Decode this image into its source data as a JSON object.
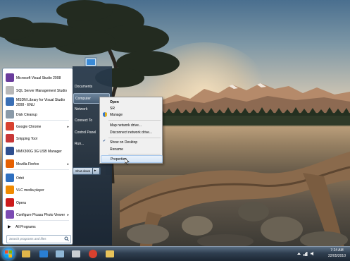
{
  "start_menu": {
    "pinned": [
      {
        "label": "Microsoft Visual Studio 2008",
        "icon": "visual-studio-icon",
        "arrow": false,
        "color": "#6a3c9c"
      },
      {
        "label": "SQL Server Management Studio",
        "icon": "sql-server-icon",
        "arrow": false,
        "color": "#b8b8b8"
      },
      {
        "label": "MSDN Library for Visual Studio 2008 - ENU",
        "icon": "msdn-library-icon",
        "arrow": false,
        "color": "#3a6fb5"
      },
      {
        "label": "Disk Cleanup",
        "icon": "disk-cleanup-icon",
        "arrow": false,
        "color": "#8a9aa8"
      },
      {
        "label": "Google Chrome",
        "icon": "chrome-icon",
        "arrow": true,
        "color": "#d8412f"
      },
      {
        "label": "Snipping Tool",
        "icon": "snipping-tool-icon",
        "arrow": false,
        "color": "#c83737"
      },
      {
        "label": "MMX300G 3G USB Manager",
        "icon": "usb-manager-icon",
        "arrow": false,
        "color": "#2f4f8f"
      },
      {
        "label": "Mozilla Firefox",
        "icon": "firefox-icon",
        "arrow": true,
        "color": "#e66000"
      },
      {
        "label": "Orbit",
        "icon": "orbit-icon",
        "arrow": false,
        "color": "#2f70c0"
      },
      {
        "label": "VLC media player",
        "icon": "vlc-icon",
        "arrow": false,
        "color": "#f08a00"
      },
      {
        "label": "Opera",
        "icon": "opera-icon",
        "arrow": false,
        "color": "#cc1b1b"
      },
      {
        "label": "Configure Picasa Photo Viewer",
        "icon": "picasa-icon",
        "arrow": true,
        "color": "#7c4bb3"
      }
    ],
    "all_programs": "All Programs",
    "search_placeholder": "Search programs and files",
    "right_pane": [
      "Documents",
      "Computer",
      "Network",
      "Connect To",
      "Control Panel",
      "Run..."
    ],
    "shutdown_label": "Shut down"
  },
  "context_menu": {
    "items": [
      {
        "label": "Open",
        "bold": true
      },
      {
        "label": "SR",
        "bold": false
      },
      {
        "label": "Manage",
        "bold": false,
        "shield": true
      },
      {
        "label": "Map network drive...",
        "bold": false
      },
      {
        "label": "Disconnect network drive...",
        "bold": false
      },
      {
        "label": "Show on Desktop",
        "bold": false,
        "checked": true
      },
      {
        "label": "Rename",
        "bold": false
      },
      {
        "label": "Properties",
        "bold": false,
        "hover": true
      }
    ]
  },
  "taskbar": {
    "pinned_icons": [
      "explorer-icon",
      "media-player-icon",
      "paint-icon",
      "tools-icon",
      "chrome-icon",
      "folder-icon"
    ],
    "clock_time": "7:24 AM",
    "clock_date": "22/05/2010"
  }
}
